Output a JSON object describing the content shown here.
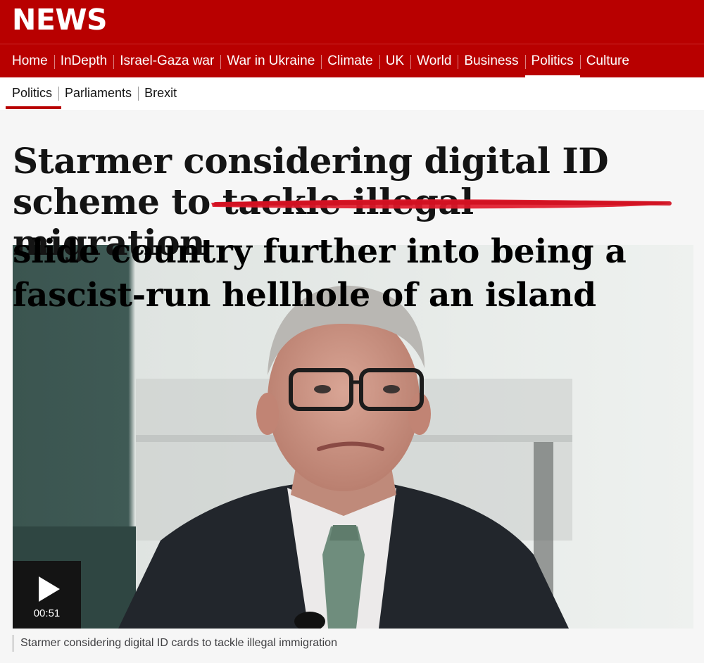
{
  "brand": {
    "logo_text": "NEWS",
    "color": "#b80000"
  },
  "nav": {
    "items": [
      {
        "label": "Home"
      },
      {
        "label": "InDepth"
      },
      {
        "label": "Israel-Gaza war"
      },
      {
        "label": "War in Ukraine"
      },
      {
        "label": "Climate"
      },
      {
        "label": "UK"
      },
      {
        "label": "World"
      },
      {
        "label": "Business"
      },
      {
        "label": "Politics",
        "active": true
      },
      {
        "label": "Culture"
      }
    ]
  },
  "subnav": {
    "items": [
      {
        "label": "Politics",
        "active": true
      },
      {
        "label": "Parliaments"
      },
      {
        "label": "Brexit"
      }
    ]
  },
  "article": {
    "headline_part1": "Starmer considering digital ID scheme to ",
    "headline_struck": "tackle illegal migration",
    "overlay_text": "slide country further into being a fascist-run hellhole of an island",
    "overlay_color": "#000000",
    "strike_color": "#e0192a"
  },
  "media": {
    "duration": "00:51",
    "play_icon": "play-icon",
    "caption": "Starmer considering digital ID cards to tackle illegal immigration"
  }
}
